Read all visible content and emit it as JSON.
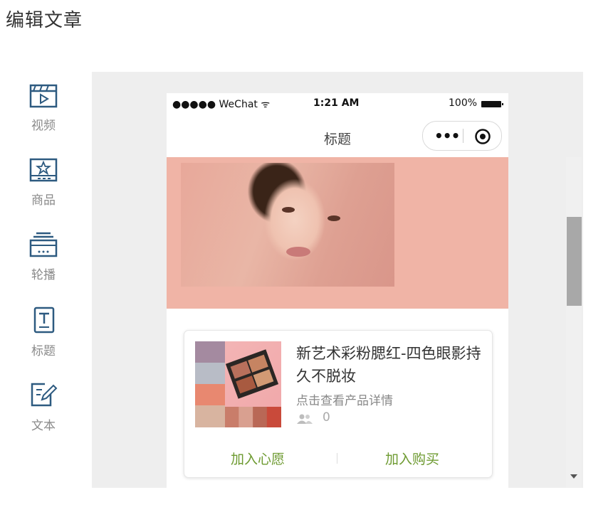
{
  "page": {
    "title": "编辑文章"
  },
  "tools": [
    {
      "label": "视频",
      "icon": "video-icon"
    },
    {
      "label": "商品",
      "icon": "product-icon"
    },
    {
      "label": "轮播",
      "icon": "carousel-icon"
    },
    {
      "label": "标题",
      "icon": "title-icon"
    },
    {
      "label": "文本",
      "icon": "text-icon"
    }
  ],
  "phone": {
    "status": {
      "carrier": "●●●●● WeChat ᯤ",
      "time": "1:21 AM",
      "battery": "100%"
    },
    "nav": {
      "title": "标题",
      "more_label": "•••"
    },
    "banner": {
      "image": "beauty-portrait-banner"
    },
    "product": {
      "name": "新艺术彩粉腮红-四色眼影持久不脱妆",
      "detail_link": "点击查看产品详情",
      "likes": "0",
      "wish_label": "加入心愿",
      "buy_label": "加入购买"
    }
  },
  "colors": {
    "accent_green": "#6d9a30",
    "icon_blue": "#2d5a80",
    "banner_bg": "#f0b4a6"
  }
}
